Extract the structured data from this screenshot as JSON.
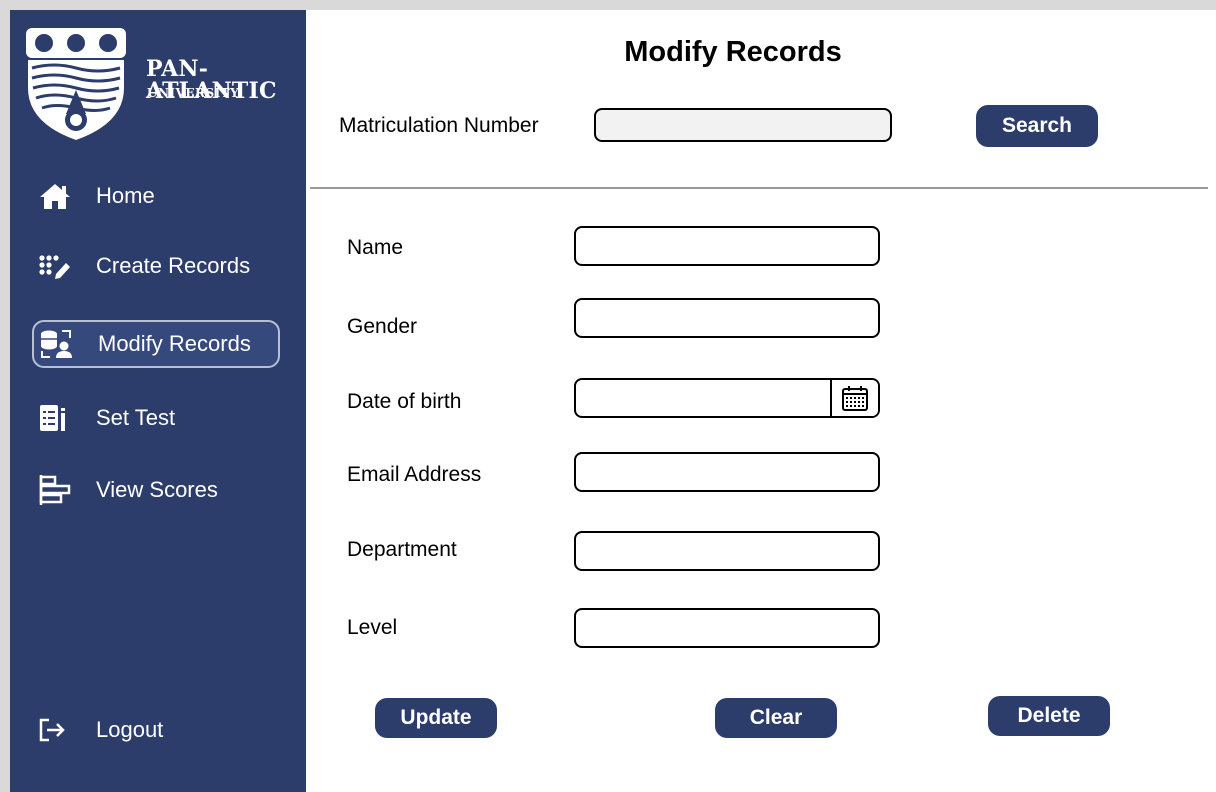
{
  "brand": {
    "name": "PAN-ATLANTIC",
    "sub": "UNIVERSITY"
  },
  "sidebar": {
    "items": [
      {
        "label": "Home",
        "icon": "home-icon"
      },
      {
        "label": "Create Records",
        "icon": "create-records-icon"
      },
      {
        "label": "Modify Records",
        "icon": "modify-records-icon",
        "active": true
      },
      {
        "label": "Set Test",
        "icon": "set-test-icon"
      },
      {
        "label": "View Scores",
        "icon": "view-scores-icon"
      }
    ],
    "logout": {
      "label": "Logout",
      "icon": "logout-icon"
    }
  },
  "page": {
    "title": "Modify Records"
  },
  "search": {
    "label": "Matriculation Number",
    "value": "",
    "button": "Search"
  },
  "form": {
    "name_label": "Name",
    "gender_label": "Gender",
    "dob_label": "Date of birth",
    "email_label": "Email Address",
    "department_label": "Department",
    "level_label": "Level"
  },
  "actions": {
    "update": "Update",
    "clear": "Clear",
    "delete": "Delete"
  },
  "colors": {
    "sidebar": "#2c3d6b",
    "button": "#2c3d6b",
    "active_border": "#b8c0d4"
  }
}
